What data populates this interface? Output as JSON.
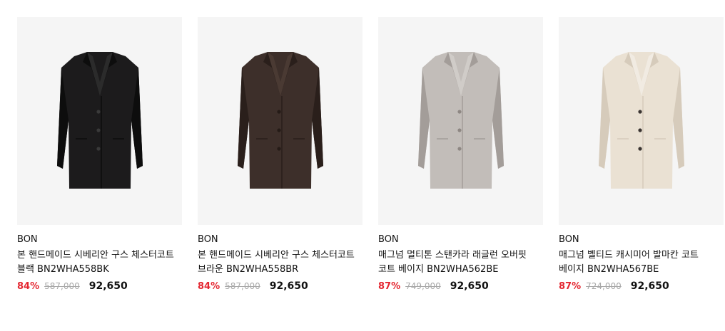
{
  "products": [
    {
      "brand": "BON",
      "name": "본 핸드메이드 시베리안 구스 체스터코트 블랙 BN2WHA558BK",
      "discount": "84%",
      "original_price": "587,000",
      "sale_price": "92,650",
      "image_icon": "coat-black-icon",
      "colors": {
        "coat": "#1c1b1c",
        "shade": "#0d0d0d",
        "lining": "#2b2b2b",
        "button": "#3a3a3a"
      }
    },
    {
      "brand": "BON",
      "name": "본 핸드메이드 시베리안 구스 체스터코트 브라운 BN2WHA558BR",
      "discount": "84%",
      "original_price": "587,000",
      "sale_price": "92,650",
      "image_icon": "coat-brown-icon",
      "colors": {
        "coat": "#3d2f2a",
        "shade": "#2a1f1b",
        "lining": "#4a3a33",
        "button": "#251b17"
      }
    },
    {
      "brand": "BON",
      "name": "매그넘 멀티톤 스탠카라 래글런 오버핏 코트 베이지 BN2WHA562BE",
      "discount": "87%",
      "original_price": "749,000",
      "sale_price": "92,650",
      "image_icon": "coat-gray-icon",
      "colors": {
        "coat": "#c2bdb9",
        "shade": "#a39d99",
        "lining": "#d0ccc8",
        "button": "#8e8783"
      }
    },
    {
      "brand": "BON",
      "name": "매그넘 벨티드 캐시미어 발마칸 코트 베이지 BN2WHA567BE",
      "discount": "87%",
      "original_price": "724,000",
      "sale_price": "92,650",
      "image_icon": "coat-beige-icon",
      "colors": {
        "coat": "#eae1d3",
        "shade": "#d6cbbb",
        "lining": "#f1ebe2",
        "button": "#3a3431"
      }
    }
  ]
}
